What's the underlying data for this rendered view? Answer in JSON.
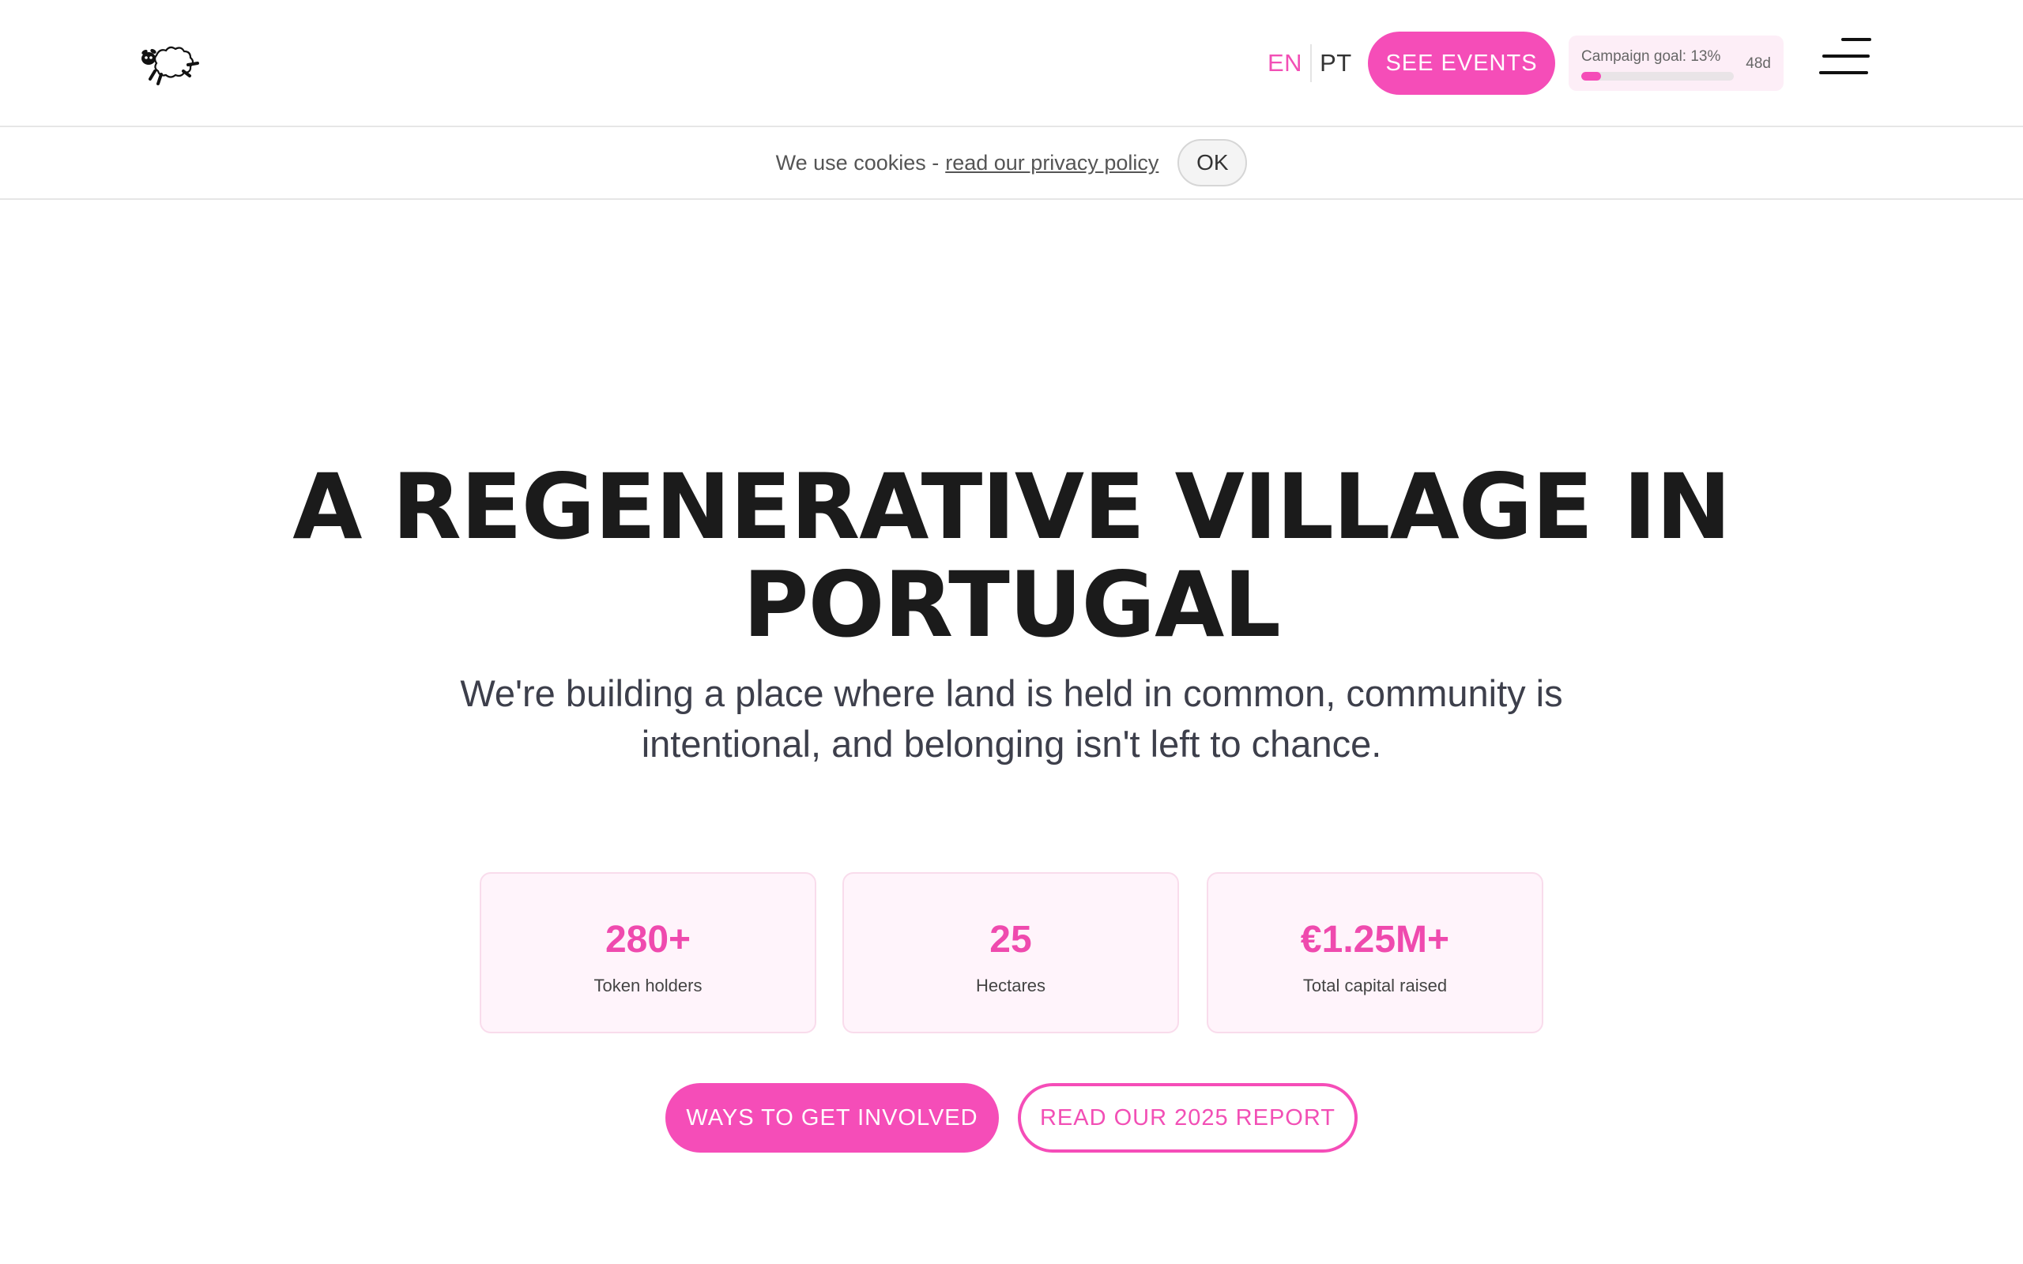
{
  "header": {
    "logo_icon": "sheep-logo-icon",
    "languages": [
      "EN",
      "PT"
    ],
    "active_language": "EN",
    "events_button": "SEE EVENTS",
    "campaign": {
      "label": "Campaign goal: 13%",
      "progress_percent": 13,
      "days_left": "48d"
    },
    "menu_icon": "hamburger-menu-icon"
  },
  "cookie_bar": {
    "text": "We use cookies -",
    "link": "read our privacy policy",
    "ok_button": "OK"
  },
  "hero": {
    "title": "A REGENERATIVE VILLAGE IN PORTUGAL",
    "subtitle": "We're building a place where land is held in common, community is intentional, and belonging isn't left to chance.",
    "stats": [
      {
        "value": "280+",
        "label": "Token holders"
      },
      {
        "value": "25",
        "label": "Hectares"
      },
      {
        "value": "€1.25M+",
        "label": "Total capital raised"
      }
    ],
    "primary_cta": "WAYS TO GET INVOLVED",
    "secondary_cta": "READ OUR 2025 REPORT"
  },
  "colors": {
    "accent": "#f54db8",
    "card_background": "#fff4fb",
    "text_dark": "#1b1b1b"
  }
}
